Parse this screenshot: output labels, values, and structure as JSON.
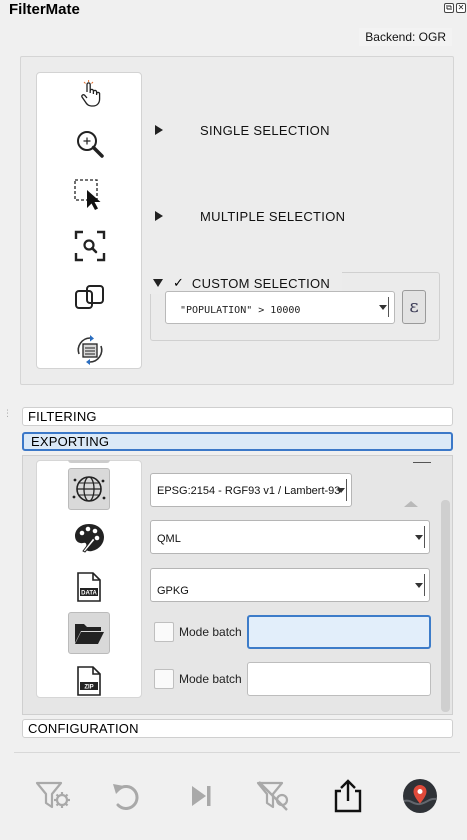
{
  "app": {
    "title": "FilterMate",
    "float_glyph": "⧉",
    "close_glyph": "✕"
  },
  "backend": {
    "label": "Backend: OGR"
  },
  "selection": {
    "tools": [
      {
        "icon": "pointer-hand-icon"
      },
      {
        "icon": "zoom-in-icon"
      },
      {
        "icon": "select-rectangle-icon"
      },
      {
        "icon": "zoom-to-selection-icon"
      },
      {
        "icon": "duplicate-icon"
      },
      {
        "icon": "refresh-layer-icon"
      }
    ],
    "single_label": "SINGLE SELECTION",
    "multiple_label": "MULTIPLE SELECTION",
    "custom_label": "CUSTOM SELECTION",
    "custom_checked": "✓",
    "expression": "\"POPULATION\" > 10000",
    "expression_button": "ε"
  },
  "tabs": {
    "filtering": "FILTERING",
    "exporting": "EXPORTING",
    "configuration": "CONFIGURATION"
  },
  "exporting": {
    "icons": [
      "layers-icon",
      "projection-globe-icon",
      "style-palette-icon",
      "data-file-icon",
      "folder-open-icon",
      "zip-file-icon"
    ],
    "crs_value": "EPSG:2154 - RGF93 v1 / Lambert-93",
    "style_value": "QML",
    "format_value": "GPKG",
    "mode_batch_1": "Mode batch",
    "mode_batch_2": "Mode batch",
    "output_folder_value": "",
    "zip_value": "",
    "data_icon_text": "DATA",
    "zip_icon_text": "ZIP"
  },
  "actions": [
    {
      "name": "filter-action",
      "icon": "filter-icon",
      "enabled": false
    },
    {
      "name": "undo-action",
      "icon": "undo-icon",
      "enabled": false
    },
    {
      "name": "next-action",
      "icon": "skip-next-icon",
      "enabled": false
    },
    {
      "name": "unfilter-action",
      "icon": "unfilter-icon",
      "enabled": false
    },
    {
      "name": "export-action",
      "icon": "export-icon",
      "enabled": true
    },
    {
      "name": "map-action",
      "icon": "map-pin-icon",
      "enabled": true
    }
  ],
  "colors": {
    "accent": "#3b78c8",
    "disabled": "#a9a9a9",
    "pin": "#e04a3a"
  }
}
